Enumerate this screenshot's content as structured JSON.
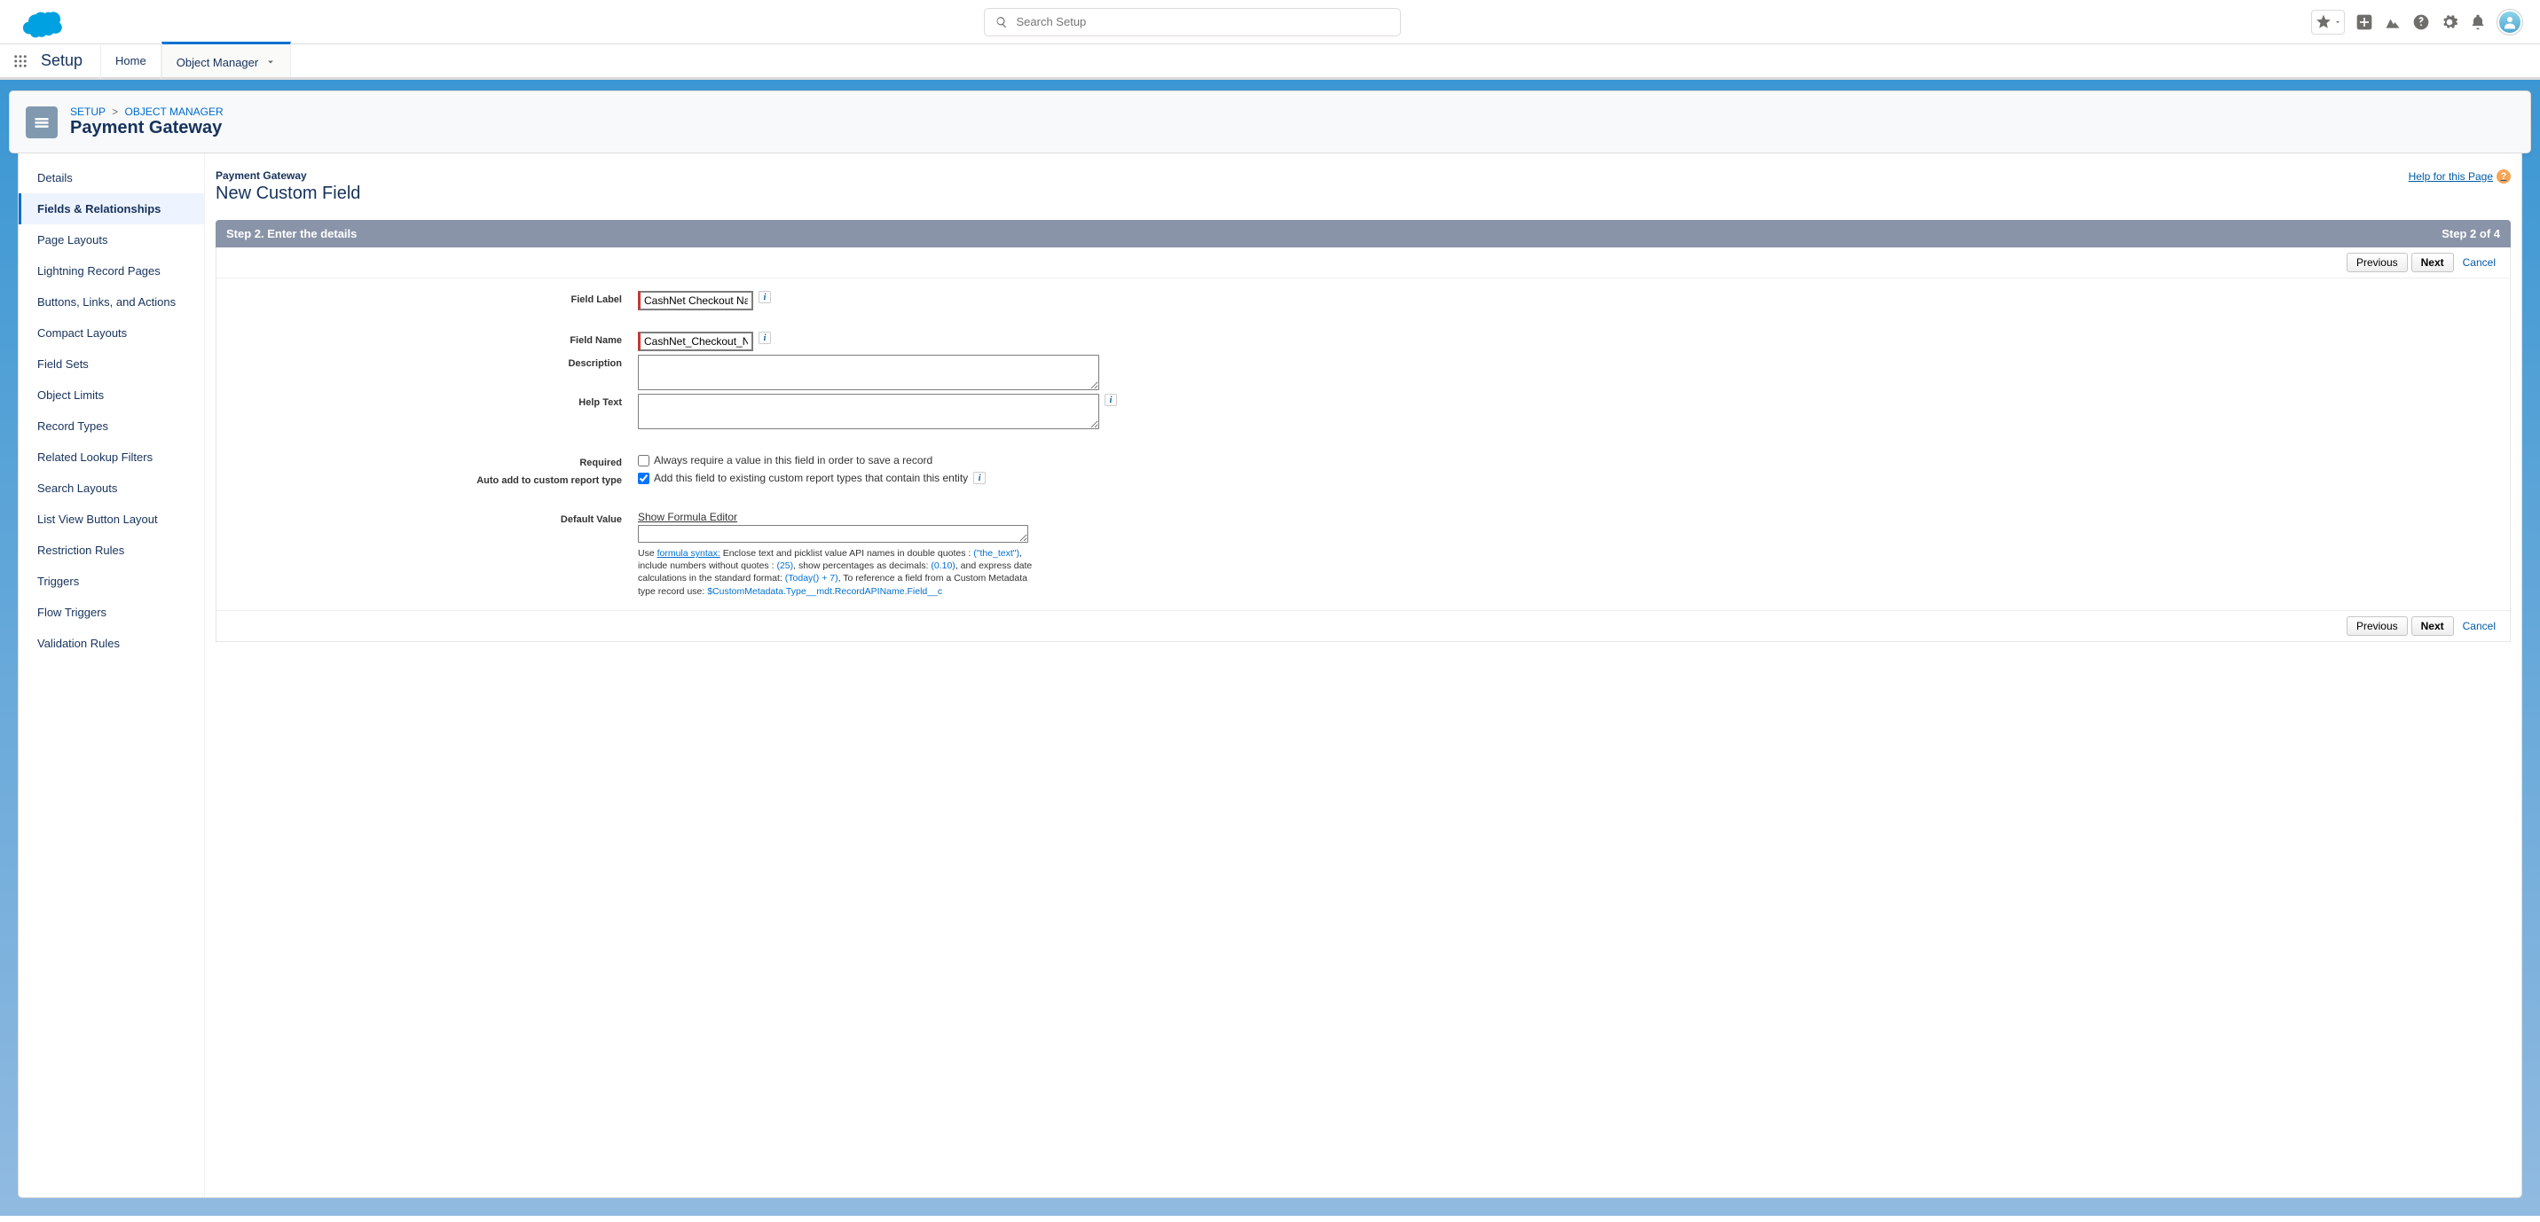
{
  "header": {
    "search_placeholder": "Search Setup"
  },
  "nav": {
    "app_label": "Setup",
    "tabs": [
      {
        "label": "Home"
      },
      {
        "label": "Object Manager"
      }
    ]
  },
  "breadcrumb": {
    "setup": "SETUP",
    "object_manager": "OBJECT MANAGER"
  },
  "page": {
    "title": "Payment Gateway"
  },
  "sidebar": {
    "items": [
      "Details",
      "Fields & Relationships",
      "Page Layouts",
      "Lightning Record Pages",
      "Buttons, Links, and Actions",
      "Compact Layouts",
      "Field Sets",
      "Object Limits",
      "Record Types",
      "Related Lookup Filters",
      "Search Layouts",
      "List View Button Layout",
      "Restriction Rules",
      "Triggers",
      "Flow Triggers",
      "Validation Rules"
    ]
  },
  "content": {
    "object_sub": "Payment Gateway",
    "heading": "New Custom Field",
    "help_link": "Help for this Page",
    "step_title": "Step 2. Enter the details",
    "step_of": "Step 2 of 4",
    "buttons": {
      "previous": "Previous",
      "next": "Next",
      "cancel": "Cancel"
    },
    "form": {
      "field_label": {
        "label": "Field Label",
        "value": "CashNet Checkout Name"
      },
      "field_name": {
        "label": "Field Name",
        "value": "CashNet_Checkout_Name"
      },
      "description": {
        "label": "Description",
        "value": ""
      },
      "help_text": {
        "label": "Help Text",
        "value": ""
      },
      "required": {
        "label": "Required",
        "text": "Always require a value in this field in order to save a record",
        "checked": false
      },
      "auto_add": {
        "label": "Auto add to custom report type",
        "text": "Add this field to existing custom report types that contain this entity",
        "checked": true
      },
      "default_value": {
        "label": "Default Value",
        "show_formula": "Show Formula Editor",
        "value": ""
      },
      "hint": {
        "t1": "Use ",
        "syntax": "formula syntax:",
        "t2": " Enclose text and picklist value API names in double quotes : ",
        "ex1": "(\"the_text\")",
        "t3": ", include numbers without quotes : ",
        "ex2": "(25)",
        "t4": ", show percentages as decimals: ",
        "ex3": "(0.10)",
        "t5": ", and express date calculations in the standard format: ",
        "ex4": "(Today() + 7)",
        "t6": ", To reference a field from a Custom Metadata type record use: ",
        "ex5": "$CustomMetadata.Type__mdt.RecordAPIName.Field__c"
      }
    }
  }
}
